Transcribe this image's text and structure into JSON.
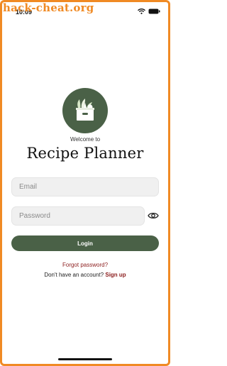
{
  "watermark": "hack-cheat.org",
  "status_bar": {
    "time": "10:09"
  },
  "header": {
    "welcome_text": "Welcome to",
    "app_title": "Recipe Planner"
  },
  "form": {
    "email_placeholder": "Email",
    "email_value": "",
    "password_placeholder": "Password",
    "password_value": "",
    "login_label": "Login"
  },
  "links": {
    "forgot_password": "Forgot password?",
    "no_account_text": "Don't have an account?",
    "signup_label": "Sign up"
  },
  "colors": {
    "brand_green": "#4a6147",
    "link_red": "#8b1c1c",
    "watermark_orange": "#f08a24"
  },
  "icons": [
    "wifi-icon",
    "battery-icon",
    "grocery-box-icon",
    "eye-icon"
  ]
}
